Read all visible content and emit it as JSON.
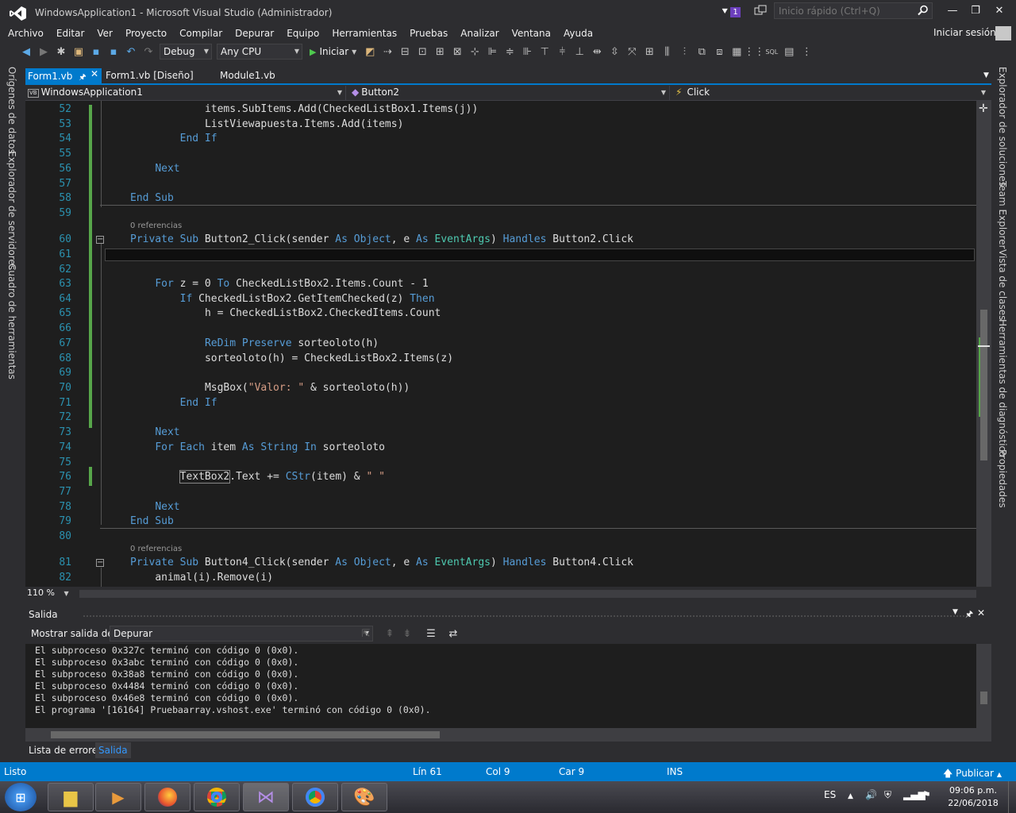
{
  "window": {
    "title": "WindowsApplication1 - Microsoft Visual Studio (Administrador)",
    "notification_count": "1",
    "quick_launch_placeholder": "Inicio rápido (Ctrl+Q)",
    "signin": "Iniciar sesión"
  },
  "menu": [
    "Archivo",
    "Editar",
    "Ver",
    "Proyecto",
    "Compilar",
    "Depurar",
    "Equipo",
    "Herramientas",
    "Pruebas",
    "Analizar",
    "Ventana",
    "Ayuda"
  ],
  "toolbar": {
    "config": "Debug",
    "platform": "Any CPU",
    "start_label": "Iniciar"
  },
  "left_tabs": [
    "Orígenes de datos",
    "Explorador de servidores",
    "Cuadro de herramientas"
  ],
  "right_tabs": [
    "Explorador de soluciones",
    "Team Explorer",
    "Vista de clases",
    "Herramientas de diagnóstico",
    "Propiedades"
  ],
  "doc_tabs": [
    {
      "label": "Form1.vb",
      "active": true
    },
    {
      "label": "Form1.vb [Diseño]",
      "active": false
    },
    {
      "label": "Module1.vb",
      "active": false
    }
  ],
  "navbar": {
    "project": "WindowsApplication1",
    "object": "Button2",
    "event": "Click"
  },
  "code": {
    "lines": [
      {
        "n": "52",
        "indent": 12,
        "html": "items.SubItems.Add(CheckedListBox1.Items(j))"
      },
      {
        "n": "53",
        "indent": 12,
        "html": "ListViewapuesta.Items.Add(items)"
      },
      {
        "n": "54",
        "indent": 8,
        "html": "<span class=\"kw\">End If</span>"
      },
      {
        "n": "55",
        "indent": 0,
        "html": ""
      },
      {
        "n": "56",
        "indent": 4,
        "html": "<span class=\"kw\">Next</span>"
      },
      {
        "n": "57",
        "indent": 0,
        "html": ""
      },
      {
        "n": "58",
        "indent": 0,
        "html": "<span class=\"kw\">End Sub</span>"
      },
      {
        "n": "59",
        "indent": 0,
        "html": ""
      },
      {
        "n": "60",
        "indent": 0,
        "html": "<span class=\"kw\">Private Sub</span> Button2_Click(sender <span class=\"kw\">As</span> <span class=\"kw\">Object</span>, e <span class=\"kw\">As</span> <span class=\"ty\">EventArgs</span>) <span class=\"kw\">Handles</span> Button2.Click"
      },
      {
        "n": "61",
        "indent": 0,
        "html": ""
      },
      {
        "n": "62",
        "indent": 0,
        "html": ""
      },
      {
        "n": "63",
        "indent": 4,
        "html": "<span class=\"kw\">For</span> z = 0 <span class=\"kw\">To</span> CheckedListBox2.Items.Count - 1"
      },
      {
        "n": "64",
        "indent": 8,
        "html": "<span class=\"kw\">If</span> CheckedListBox2.GetItemChecked(z) <span class=\"kw\">Then</span>"
      },
      {
        "n": "65",
        "indent": 12,
        "html": "h = CheckedListBox2.CheckedItems.Count"
      },
      {
        "n": "66",
        "indent": 0,
        "html": ""
      },
      {
        "n": "67",
        "indent": 12,
        "html": "<span class=\"kw\">ReDim Preserve</span> sorteoloto(h)"
      },
      {
        "n": "68",
        "indent": 12,
        "html": "sorteoloto(h) = CheckedListBox2.Items(z)"
      },
      {
        "n": "69",
        "indent": 0,
        "html": ""
      },
      {
        "n": "70",
        "indent": 12,
        "html": "MsgBox(<span class=\"st\">\"Valor: \"</span> &amp; sorteoloto(h))"
      },
      {
        "n": "71",
        "indent": 8,
        "html": "<span class=\"kw\">End If</span>"
      },
      {
        "n": "72",
        "indent": 0,
        "html": ""
      },
      {
        "n": "73",
        "indent": 4,
        "html": "<span class=\"kw\">Next</span>"
      },
      {
        "n": "74",
        "indent": 4,
        "html": "<span class=\"kw\">For Each</span> item <span class=\"kw\">As</span> <span class=\"kw\">String</span> <span class=\"kw\">In</span> sorteoloto"
      },
      {
        "n": "75",
        "indent": 0,
        "html": ""
      },
      {
        "n": "76",
        "indent": 8,
        "html": "<span class=\"hl-box\">TextBox2</span>.Text += <span class=\"kw\">CStr</span>(item) &amp; <span class=\"st\">\" \"</span>"
      },
      {
        "n": "77",
        "indent": 0,
        "html": ""
      },
      {
        "n": "78",
        "indent": 4,
        "html": "<span class=\"kw\">Next</span>"
      },
      {
        "n": "79",
        "indent": 0,
        "html": "<span class=\"kw\">End Sub</span>"
      },
      {
        "n": "80",
        "indent": 0,
        "html": ""
      },
      {
        "n": "81",
        "indent": 0,
        "html": "<span class=\"kw\">Private Sub</span> Button4_Click(sender <span class=\"kw\">As</span> <span class=\"kw\">Object</span>, e <span class=\"kw\">As</span> <span class=\"ty\">EventArgs</span>) <span class=\"kw\">Handles</span> Button4.Click"
      },
      {
        "n": "82",
        "indent": 4,
        "html": "animal(i).Remove(i)"
      }
    ],
    "codelens_60": "0 referencias",
    "codelens_81": "0 referencias"
  },
  "zoom": "110 %",
  "output": {
    "title": "Salida",
    "show_label": "Mostrar salida de:",
    "source": "Depurar",
    "lines": [
      "El subproceso 0x327c terminó con código 0 (0x0).",
      "El subproceso 0x3abc terminó con código 0 (0x0).",
      "El subproceso 0x38a8 terminó con código 0 (0x0).",
      "El subproceso 0x4484 terminó con código 0 (0x0).",
      "El subproceso 0x46e8 terminó con código 0 (0x0).",
      "El programa '[16164] Pruebaarray.vshost.exe' terminó con código 0 (0x0)."
    ]
  },
  "panel_tabs": [
    {
      "label": "Lista de errores",
      "active": false
    },
    {
      "label": "Salida",
      "active": true
    }
  ],
  "status": {
    "state": "Listo",
    "line": "Lín 61",
    "col": "Col 9",
    "car": "Car 9",
    "mode": "INS",
    "publish": "Publicar"
  },
  "taskbar": {
    "lang": "ES",
    "time": "09:06 p.m.",
    "date": "22/06/2018"
  },
  "colors": {
    "accent": "#007acc",
    "keyword": "#569cd6",
    "type": "#4ec9b0",
    "string": "#d69d85",
    "line_number": "#2b91af"
  }
}
